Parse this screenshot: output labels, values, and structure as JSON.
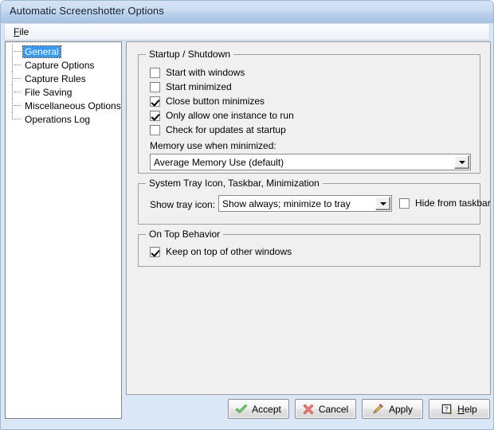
{
  "window": {
    "title": "Automatic Screenshotter Options"
  },
  "menubar": {
    "items": [
      {
        "label_before": "",
        "accel": "F",
        "label_after": "ile",
        "name": "menu-file"
      }
    ]
  },
  "sidebar": {
    "items": [
      {
        "label": "General",
        "selected": true
      },
      {
        "label": "Capture Options",
        "selected": false
      },
      {
        "label": "Capture Rules",
        "selected": false
      },
      {
        "label": "File Saving",
        "selected": false
      },
      {
        "label": "Miscellaneous Options",
        "selected": false
      },
      {
        "label": "Operations Log",
        "selected": false
      }
    ]
  },
  "main": {
    "groups": {
      "startup": {
        "title": "Startup / Shutdown",
        "checkboxes": [
          {
            "label": "Start with windows",
            "checked": false
          },
          {
            "label": "Start minimized",
            "checked": false
          },
          {
            "label": "Close button minimizes",
            "checked": true
          },
          {
            "label": "Only allow one instance to run",
            "checked": true
          },
          {
            "label": "Check for updates at startup",
            "checked": false
          }
        ],
        "memory_label": "Memory use when minimized:",
        "memory_value": "Average Memory Use (default)"
      },
      "tray": {
        "title": "System Tray Icon, Taskbar, Minimization",
        "tray_label": "Show tray icon:",
        "tray_value": "Show always; minimize to tray",
        "hide_taskbar_label": "Hide from taskbar",
        "hide_taskbar_checked": false
      },
      "ontop": {
        "title": "On Top Behavior",
        "keep_on_top_label": "Keep on top of other windows",
        "keep_on_top_checked": true
      }
    }
  },
  "buttons": {
    "accept": {
      "label": "Accept",
      "icon": "green-check-icon"
    },
    "cancel": {
      "label": "Cancel",
      "icon": "red-x-icon"
    },
    "apply": {
      "label": "Apply",
      "icon": "pencil-icon"
    },
    "help": {
      "accel": "H",
      "label_after": "elp",
      "icon": "help-question-icon"
    }
  },
  "colors": {
    "titlebar_top": "#d5e4f5",
    "titlebar_bottom": "#a8c4e4",
    "selection_blue": "#3399ff",
    "panel_gray": "#f0f0f0",
    "accept_green": "#3fa535",
    "cancel_red": "#d94a3d",
    "help_blue": "#2a5fb4"
  }
}
